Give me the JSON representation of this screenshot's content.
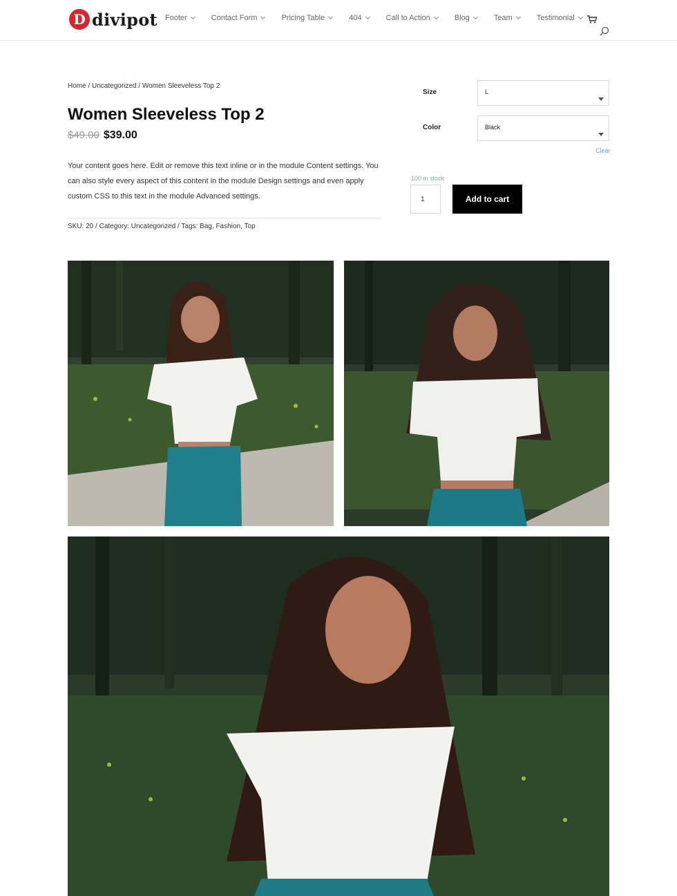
{
  "header": {
    "logo_mark": "D",
    "logo_text": "divipot",
    "nav": [
      {
        "label": "Footer"
      },
      {
        "label": "Contact Form"
      },
      {
        "label": "Pricing Table"
      },
      {
        "label": "404"
      },
      {
        "label": "Call to Action"
      },
      {
        "label": "Blog"
      },
      {
        "label": "Team"
      },
      {
        "label": "Testimonial"
      }
    ],
    "icons": {
      "cart": "cart-icon",
      "search": "search-icon"
    }
  },
  "product": {
    "breadcrumb": "Home / Uncategorized / Women Sleeveless Top 2",
    "title": "Women Sleeveless Top 2",
    "old_price": "$49.00",
    "price": "$39.00",
    "description": "Your content goes here. Edit or remove this text inline or in the module Content settings. You can also style every aspect of this content in the module Design settings and even apply custom CSS to this text in the module Advanced settings.",
    "meta": {
      "sku_label": "SKU:",
      "sku": "20",
      "category_label": "Category:",
      "category": "Uncategorized",
      "tags_label": "Tags:",
      "tags": [
        "Bag",
        "Fashion",
        "Top"
      ]
    }
  },
  "variations": {
    "size_label": "Size",
    "size_value": "L",
    "color_label": "Color",
    "color_value": "Black",
    "clear": "Clear",
    "stock": "100 in stock",
    "quantity": "1",
    "add_to_cart": "Add to cart"
  },
  "colors": {
    "brand_red": "#d7262d",
    "button_bg": "#000000",
    "stock_green": "#7fb07f",
    "link_blue": "#7aa3c8"
  }
}
